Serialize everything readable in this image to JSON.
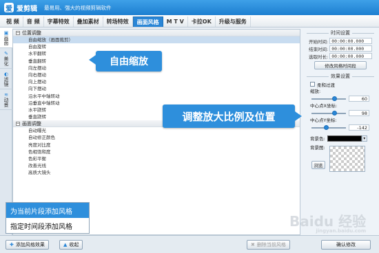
{
  "title_bar": {
    "logo": "爱",
    "app_name": "爱剪辑",
    "slogan": "最易用、强大的视频剪辑软件"
  },
  "tabs": [
    {
      "label": "视  频",
      "active": false
    },
    {
      "label": "音  频",
      "active": false
    },
    {
      "label": "字幕特效",
      "active": false
    },
    {
      "label": "叠加素材",
      "active": false
    },
    {
      "label": "转场特效",
      "active": false
    },
    {
      "label": "画面风格",
      "active": true
    },
    {
      "label": "M T V",
      "active": false
    },
    {
      "label": "卡拉OK",
      "active": false
    },
    {
      "label": "升级与服务",
      "active": false
    }
  ],
  "vtabs": [
    {
      "label": "画面",
      "icon": "image-icon",
      "glyph": "▣",
      "active": true
    },
    {
      "label": "美化",
      "icon": "brush-icon",
      "glyph": "✎",
      "active": false
    },
    {
      "label": "滤镜",
      "icon": "filter-icon",
      "glyph": "◐",
      "active": false
    },
    {
      "label": "动景",
      "icon": "motion-icon",
      "glyph": "≋",
      "active": false
    }
  ],
  "groups": [
    {
      "title": "位置调整",
      "toggle": "−",
      "items": [
        "自由缩放（画面裁剪）",
        "自由旋转",
        "水平翻转",
        "垂直翻转",
        "向左摆动",
        "向右摆动",
        "向上摆动",
        "向下摆动",
        "沿水平中轴转动",
        "沿垂直中轴转动",
        "水平跷转",
        "垂直跷转"
      ],
      "selected_index": 0
    },
    {
      "title": "画面调整",
      "toggle": "−",
      "items": [
        "自动曝光",
        "自动修正颜色",
        "亮度对比度",
        "色相饱和度",
        "色彩平衡",
        "改善光线",
        "高质大镜头"
      ],
      "selected_index": -1
    }
  ],
  "right": {
    "time_title": "时间设置",
    "start_label": "开始时间:",
    "start_value": "00:00:00.000",
    "end_label": "结束时间:",
    "end_value": "00:00:00.000",
    "dur_label": "选取时长:",
    "dur_value": "00:00:00.000",
    "modify_time_button": "修改风格时间段",
    "effect_title": "效果设置",
    "soft_transition": "柔和过渡",
    "zoom_label": "缩放:",
    "zoom_value": "60",
    "zoom_level": 0.6,
    "cx_label": "中心点X坐标:",
    "cx_value": "98",
    "cx_level": 0.6,
    "cy_label": "中心点Y坐标:",
    "cy_value": "-142",
    "cy_level": 0.35,
    "bgcolor_label": "背景色:",
    "bgcolor": "#000000",
    "dropdown_glyph": "▾",
    "bgimg_label": "背景图:",
    "browse_button": "浏览",
    "confirm_button": "确认修改"
  },
  "bottom": {
    "add_button": "添加风格效果",
    "add_glyph": "✚",
    "collapse_button": "收起",
    "collapse_glyph": "▲",
    "delete_button": "删除当前风格",
    "delete_glyph": "✖"
  },
  "callouts": {
    "free_zoom": "自由缩放",
    "adjust": "调整放大比例及位置"
  },
  "popup": {
    "item1": "为当前片段添加风格",
    "item2": "指定时间段添加风格"
  },
  "watermark": {
    "text": "Baidu 经验",
    "sub": "jingyan.baidu.com"
  },
  "colors": {
    "accent": "#2e8fdc",
    "title_bar": "#1d7fd0",
    "selected_row": "#c8dcf0"
  }
}
